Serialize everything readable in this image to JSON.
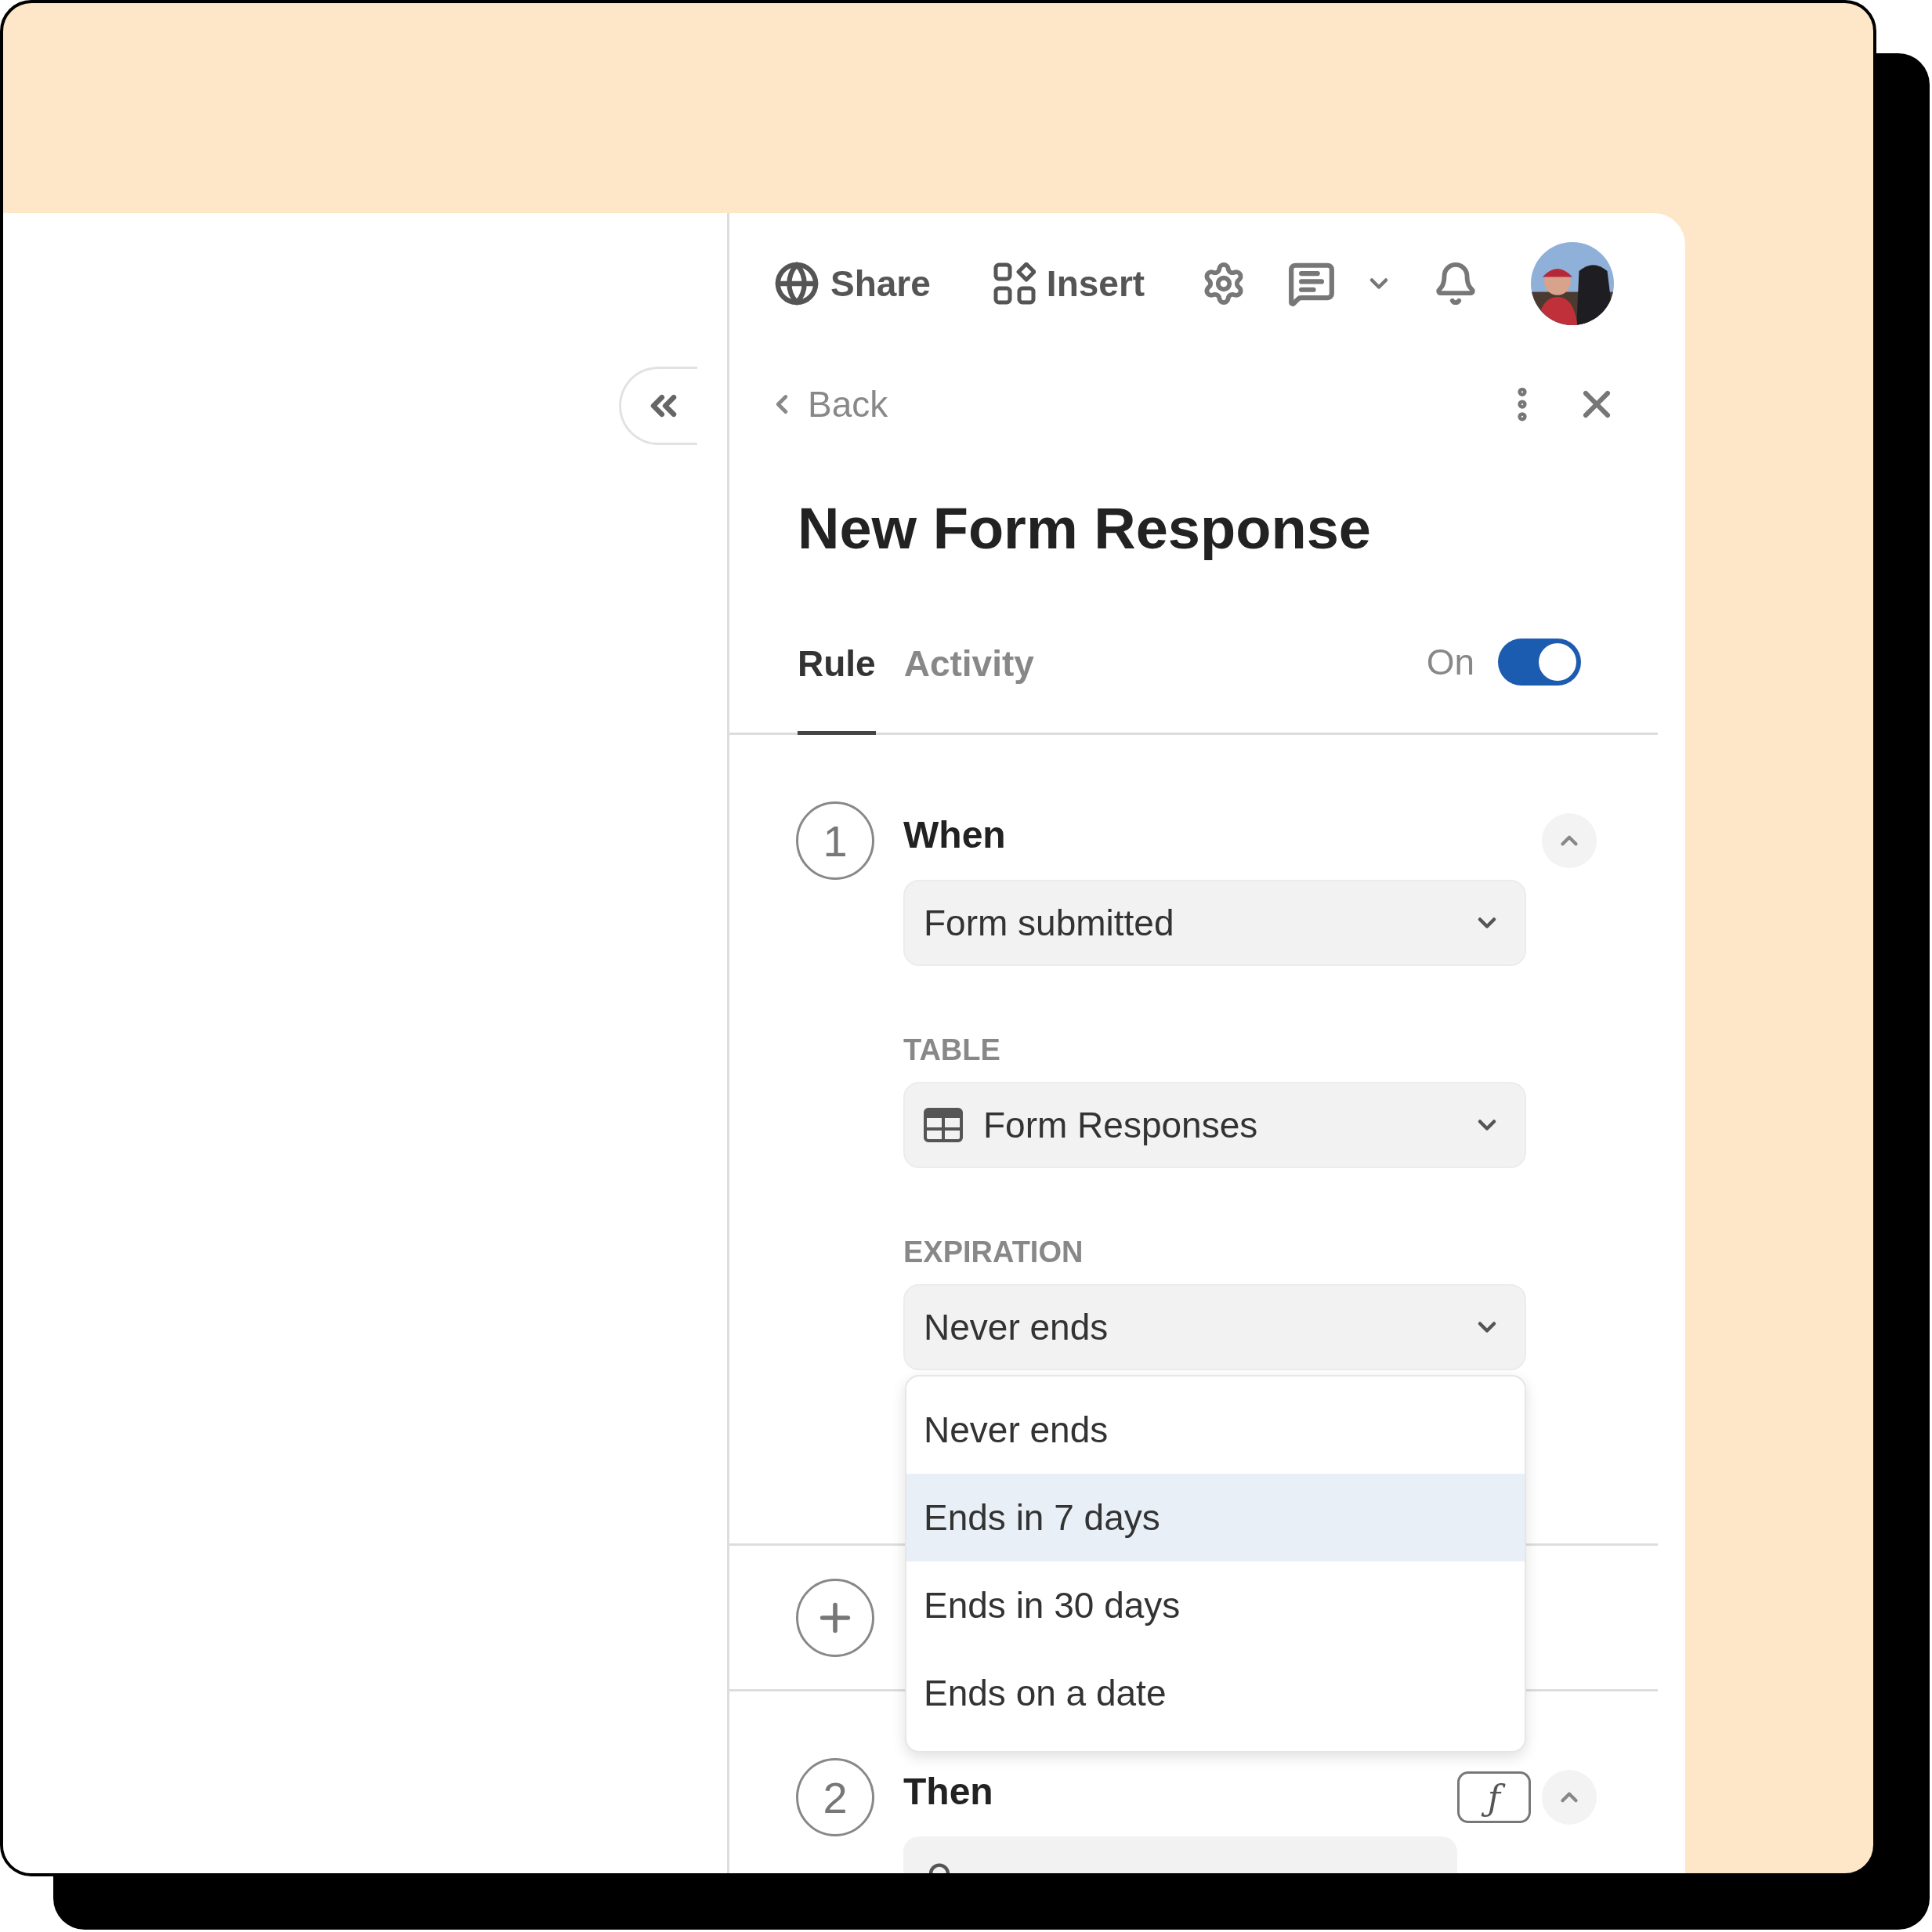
{
  "toolbar": {
    "share": "Share",
    "insert": "Insert"
  },
  "panel": {
    "back": "Back",
    "title": "New Form Response",
    "tabs": [
      {
        "label": "Rule",
        "selected": true
      },
      {
        "label": "Activity",
        "selected": false
      }
    ],
    "toggle": {
      "label": "On",
      "on": true
    }
  },
  "when": {
    "number": "1",
    "heading": "When",
    "trigger": "Form submitted",
    "fields": [
      {
        "label": "TABLE",
        "value": "Form Responses",
        "kind": "table"
      },
      {
        "label": "EXPIRATION",
        "value": "Never ends",
        "kind": "plain"
      }
    ]
  },
  "expiration_menu": [
    {
      "label": "Never ends",
      "selected": false
    },
    {
      "label": "Ends in 7 days",
      "selected": true
    },
    {
      "label": "Ends in 30 days",
      "selected": false
    },
    {
      "label": "Ends on a date",
      "selected": false
    }
  ],
  "then": {
    "number": "2",
    "heading": "Then",
    "formula": "ƒ"
  }
}
